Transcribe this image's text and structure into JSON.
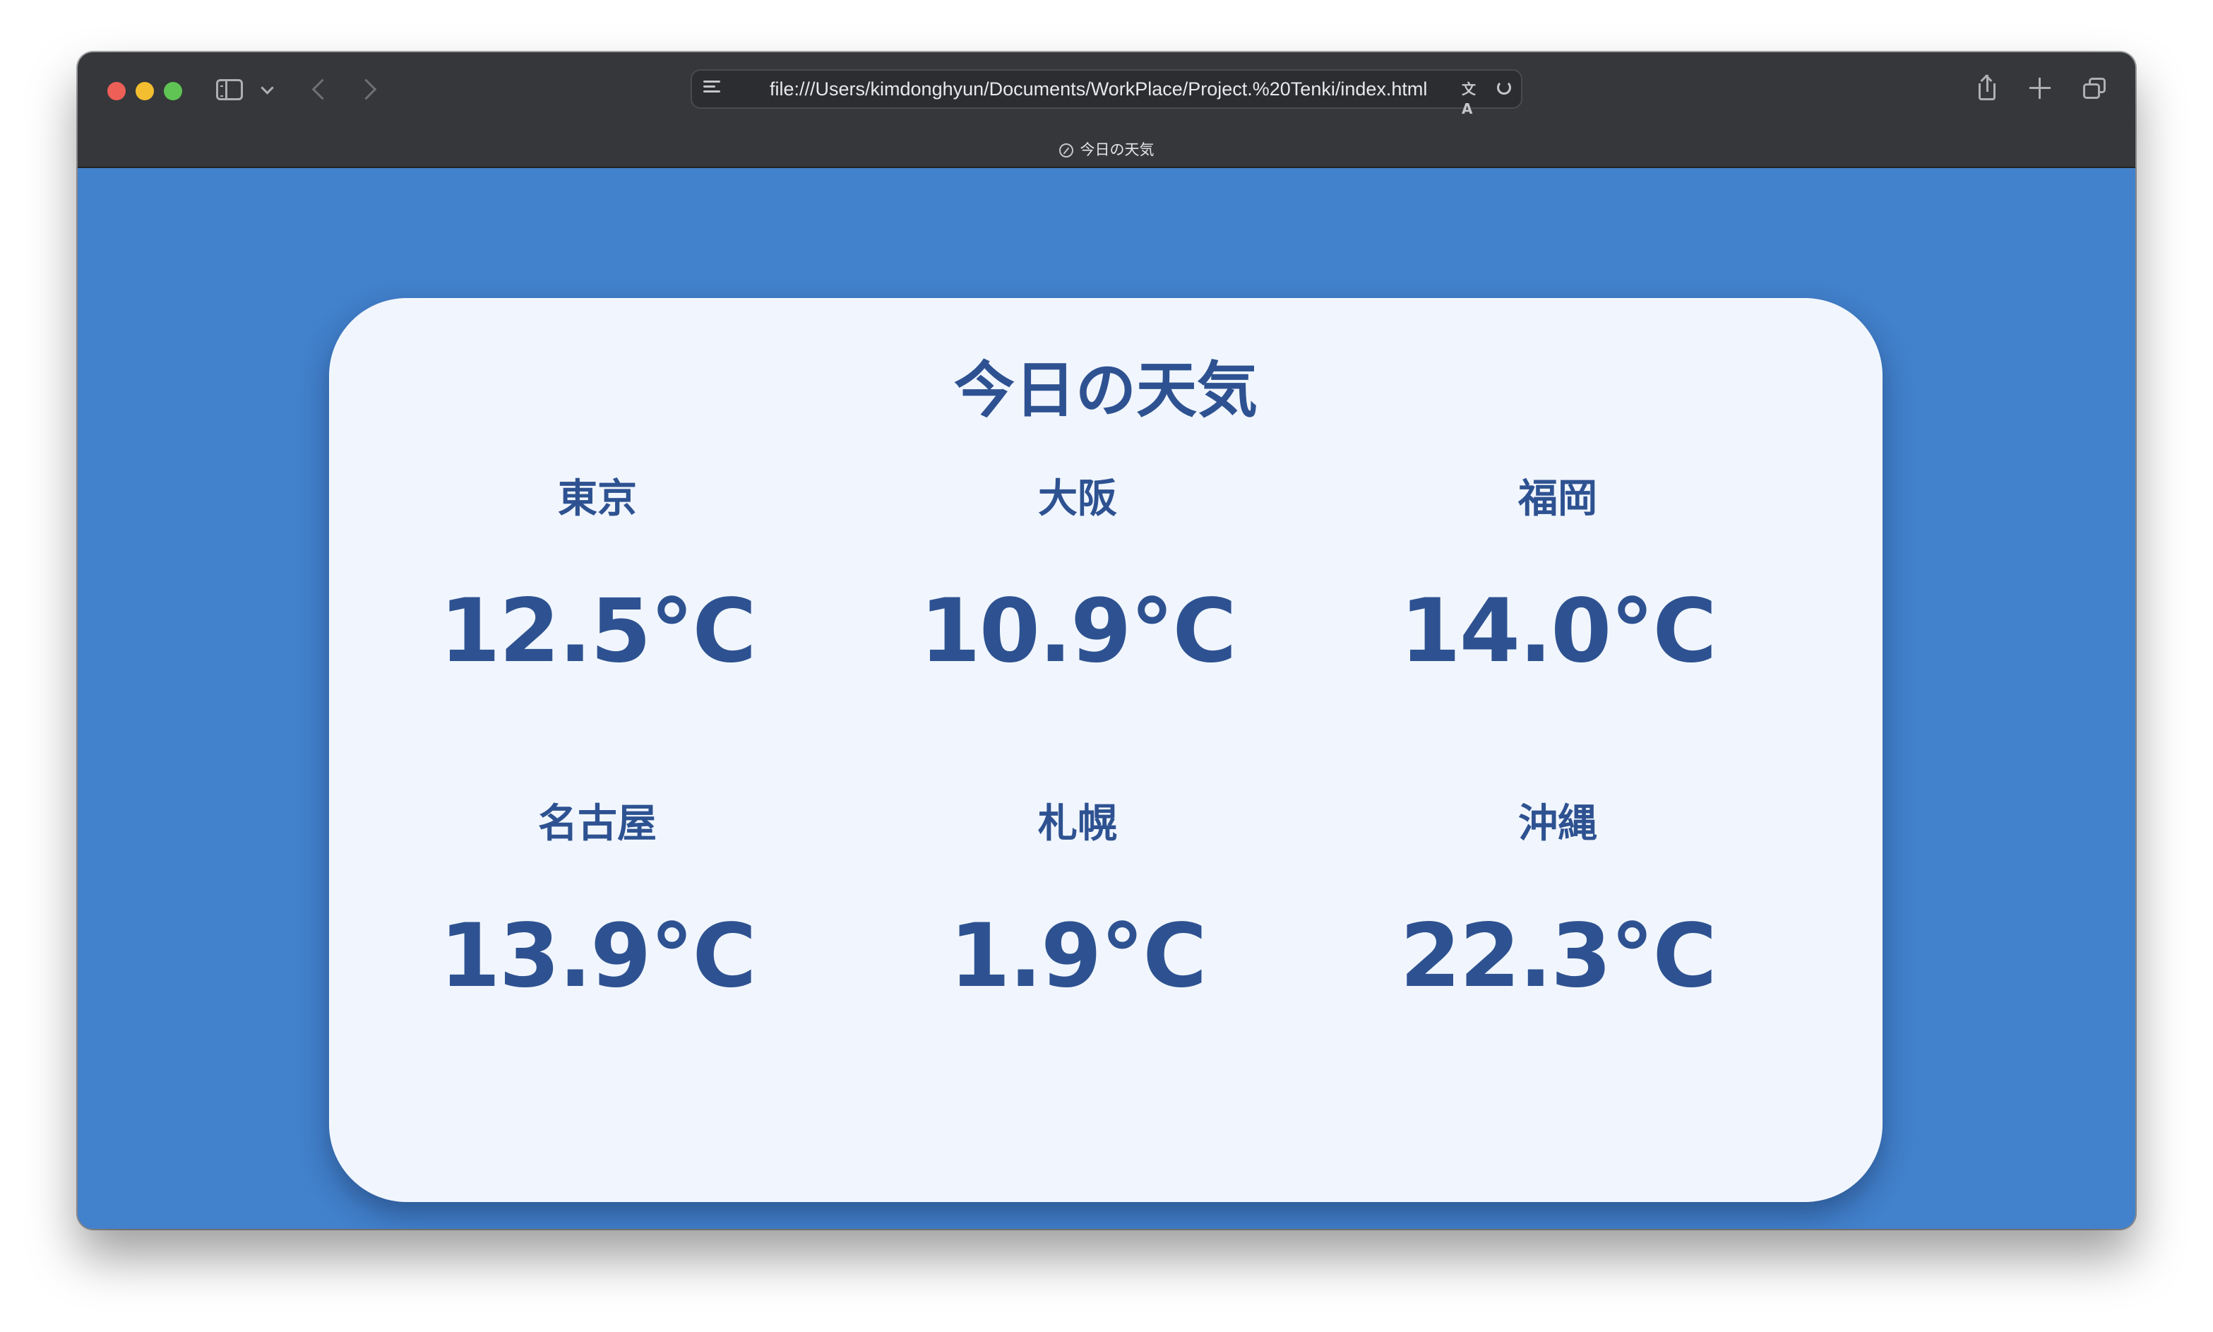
{
  "browser": {
    "url": "file:///Users/kimdonghyun/Documents/WorkPlace/Project.%20Tenki/index.html",
    "tab_title": "今日の天気",
    "icons": [
      "close-dot",
      "minimize-dot",
      "maximize-dot",
      "sidebar-icon",
      "chevron-down-icon",
      "back-arrow-icon",
      "forward-arrow-icon",
      "reader-icon",
      "translate-icon",
      "reload-icon",
      "share-icon",
      "plus-icon",
      "tabs-icon",
      "compass-icon"
    ]
  },
  "page": {
    "title": "今日の天気",
    "cities": [
      {
        "name": "東京",
        "temp": "12.5°C"
      },
      {
        "name": "大阪",
        "temp": "10.9°C"
      },
      {
        "name": "福岡",
        "temp": "14.0°C"
      },
      {
        "name": "名古屋",
        "temp": "13.9°C"
      },
      {
        "name": "札幌",
        "temp": "1.9°C"
      },
      {
        "name": "沖縄",
        "temp": "22.3°C"
      }
    ]
  },
  "colors": {
    "background": "#4281cc",
    "card": "#f1f6fe",
    "text": "#2e5291",
    "titlebar": "#36373b"
  }
}
